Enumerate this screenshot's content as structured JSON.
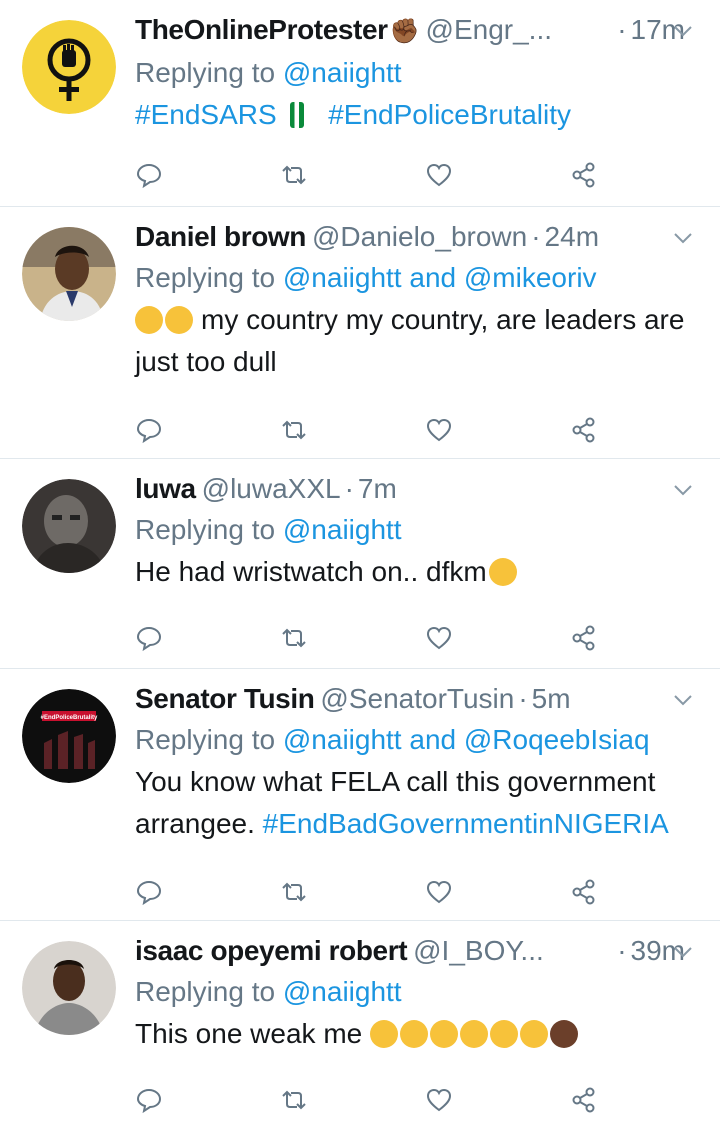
{
  "tweets": [
    {
      "name": "TheOnlineProtester",
      "name_emoji": "✊🏾",
      "handle": "@Engr_...",
      "time": "17m",
      "reply_prefix": "Replying to",
      "reply_to": "@naiightt",
      "reply_to_2": "",
      "hashtags": [
        "#EndSARS",
        "#EndPoliceBrutality"
      ],
      "text": ""
    },
    {
      "name": "Daniel brown",
      "handle": "@Danielo_brown",
      "time": "24m",
      "reply_prefix": "Replying to",
      "reply_to": "@naiightt",
      "reply_and": "and",
      "reply_to_2": "@mikeoriv",
      "text": "my country my country, are leaders are just too dull"
    },
    {
      "name": "luwa",
      "handle": "@luwaXXL",
      "time": "7m",
      "reply_prefix": "Replying to",
      "reply_to": "@naiightt",
      "text": "He had wristwatch on.. dfkm"
    },
    {
      "name": "Senator Tusin",
      "handle": "@SenatorTusin",
      "time": "5m",
      "reply_prefix": "Replying to",
      "reply_to": "@naiightt",
      "reply_and": "and",
      "reply_to_2": "@RoqeebIsiaq",
      "text": "You know what FELA call this government arrangee.",
      "hashtag": "#EndBadGovernmentinNIGERIA",
      "avatar_caption": "#EndPoliceBrutality"
    },
    {
      "name": "isaac opeyemi robert",
      "handle": "@I_BOY...",
      "time": "39m",
      "reply_prefix": "Replying to",
      "reply_to": "@naiightt",
      "text": "This one weak me"
    }
  ],
  "icons": [
    "reply-icon",
    "retweet-icon",
    "like-icon",
    "share-icon",
    "chevron-down-icon"
  ],
  "colors": {
    "link": "#1b95e0",
    "muted": "#657786",
    "divider": "#e1e8ed",
    "icon": "#657786"
  }
}
